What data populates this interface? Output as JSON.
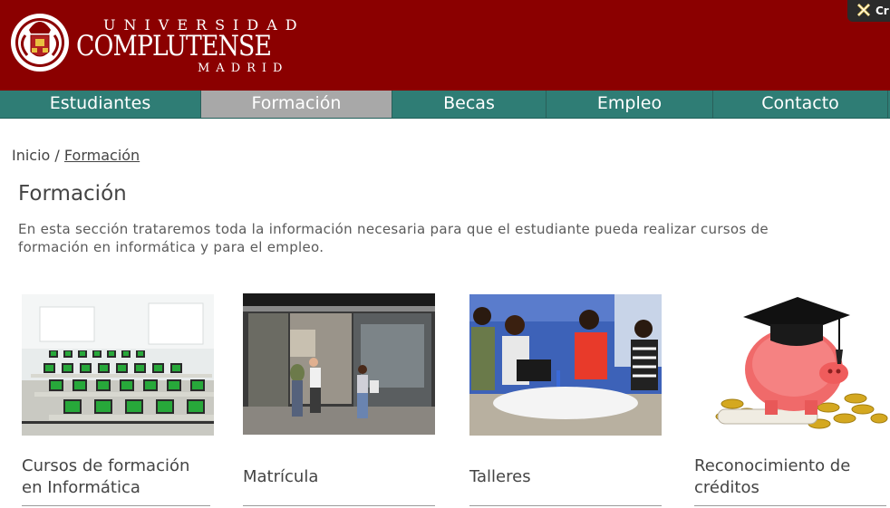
{
  "header": {
    "line1": "UNIVERSIDAD",
    "line2": "COMPLUTENSE",
    "line3": "MADRID",
    "chip_label": "Cr"
  },
  "nav": {
    "items": [
      {
        "label": "Estudiantes"
      },
      {
        "label": "Formación"
      },
      {
        "label": "Becas"
      },
      {
        "label": "Empleo"
      },
      {
        "label": "Contacto"
      }
    ],
    "active_index": 1
  },
  "breadcrumb": {
    "home": "Inicio",
    "separator": " / ",
    "current": "Formación"
  },
  "page": {
    "title": "Formación",
    "description": "En esta sección trataremos toda la información necesaria para que el estudiante pueda realizar cursos de formación en informática y para el empleo."
  },
  "cards": [
    {
      "title": "Cursos de formación en Informática",
      "image": "computer-lab-image"
    },
    {
      "title": "Matrícula",
      "image": "enrollment-office-image"
    },
    {
      "title": "Talleres",
      "image": "workshop-students-image"
    },
    {
      "title": "Reconocimiento de créditos",
      "image": "piggy-bank-graduation-image"
    }
  ],
  "colors": {
    "header": "#8b0000",
    "nav": "#2f7d75",
    "nav_active": "#a8a8a8",
    "text": "#444444"
  }
}
